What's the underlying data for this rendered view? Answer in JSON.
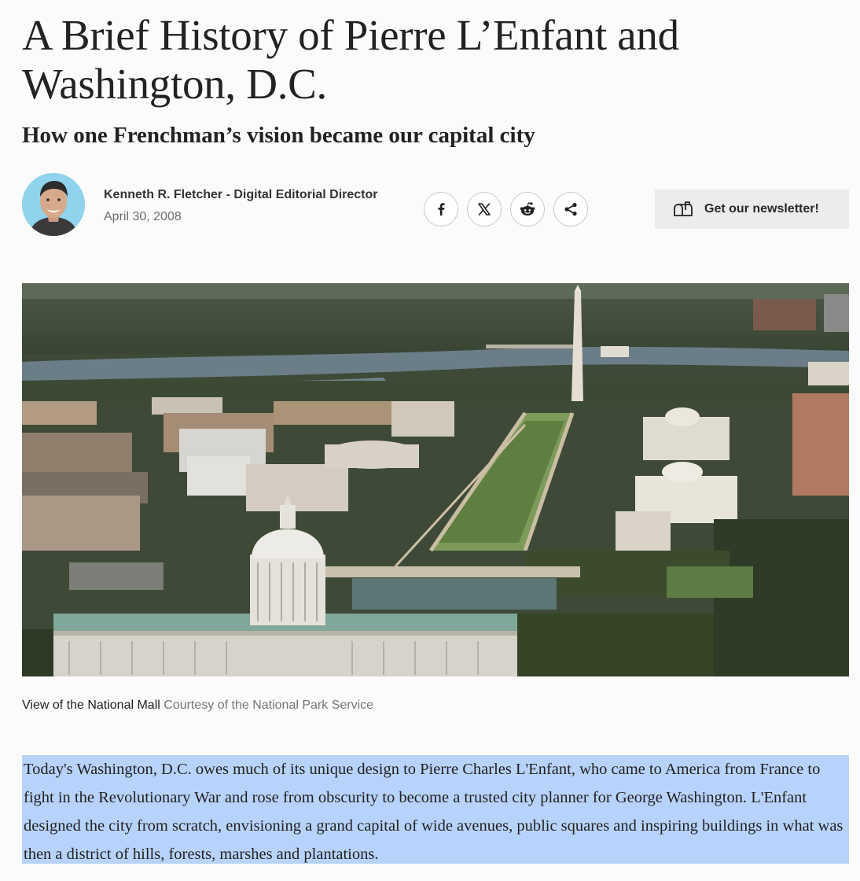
{
  "article": {
    "title": "A Brief History of Pierre L’Enfant and Washington, D.C.",
    "subtitle": "How one Frenchman’s vision became our capital city",
    "author": "Kenneth R. Fletcher - Digital Editorial Director",
    "date": "April 30, 2008",
    "share_buttons": [
      {
        "icon": "facebook-icon"
      },
      {
        "icon": "x-twitter-icon"
      },
      {
        "icon": "reddit-icon"
      },
      {
        "icon": "share-icon"
      }
    ],
    "newsletter_label": "Get our newsletter!",
    "image_caption": "View of the National Mall",
    "image_credit": "Courtesy of the National Park Service",
    "body_text": "Today's Washington, D.C. owes much of its unique design to Pierre Charles L'Enfant, who came to America from France to fight in the Revolutionary War and rose from obscurity to become a trusted city planner for George Washington. L'Enfant designed the city from scratch, envisioning a grand capital of wide avenues, public squares and inspiring buildings in what was then a district of hills, forests, marshes and plantations."
  },
  "colors": {
    "text_selection": "#b7d3fb",
    "newsletter_bg": "#ececec",
    "avatar_bg": "#8fd3ec"
  }
}
